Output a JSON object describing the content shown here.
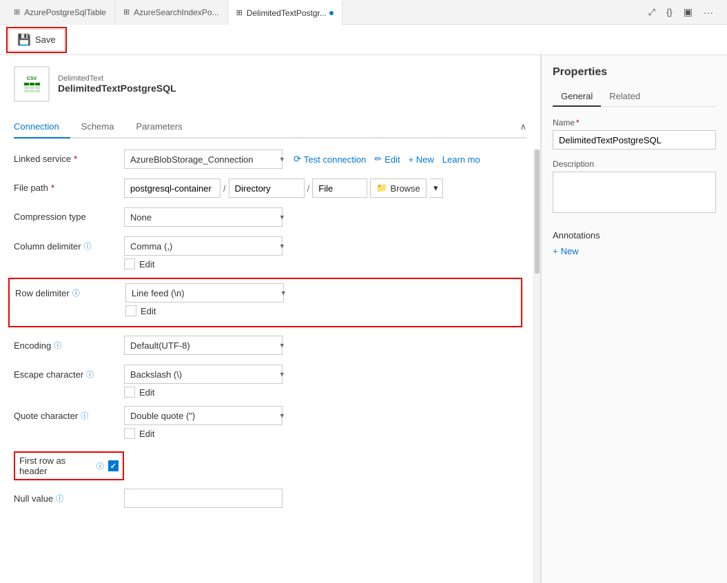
{
  "tabs": [
    {
      "id": "tab1",
      "label": "AzurePostgreSqlTable",
      "icon": "⊞",
      "active": false
    },
    {
      "id": "tab2",
      "label": "AzureSearchIndexPo...",
      "icon": "⊞",
      "active": false
    },
    {
      "id": "tab3",
      "label": "DelimitedTextPostgr...",
      "icon": "⊞",
      "active": true,
      "dot": true
    }
  ],
  "toolbar": {
    "save_label": "Save"
  },
  "dataset": {
    "type_label": "DelimitedText",
    "name_label": "DelimitedTextPostgreSQL"
  },
  "content_tabs": [
    {
      "id": "connection",
      "label": "Connection",
      "active": true
    },
    {
      "id": "schema",
      "label": "Schema",
      "active": false
    },
    {
      "id": "parameters",
      "label": "Parameters",
      "active": false
    }
  ],
  "form": {
    "linked_service_label": "Linked service",
    "linked_service_required": "*",
    "linked_service_value": "AzureBlobStorage_Connection",
    "linked_service_actions": {
      "test_connection": "Test connection",
      "edit": "Edit",
      "new": "+ New",
      "learn_more": "Learn mo"
    },
    "file_path_label": "File path",
    "file_path_required": "*",
    "file_path_container": "postgresql-container",
    "file_path_directory": "Directory",
    "file_path_file": "File",
    "browse_label": "Browse",
    "compression_type_label": "Compression type",
    "compression_type_value": "None",
    "column_delimiter_label": "Column delimiter",
    "column_delimiter_info": "ⓘ",
    "column_delimiter_value": "Comma (,)",
    "column_delimiter_edit_label": "Edit",
    "row_delimiter_label": "Row delimiter",
    "row_delimiter_info": "ⓘ",
    "row_delimiter_value": "Line feed (\\n)",
    "row_delimiter_edit_label": "Edit",
    "encoding_label": "Encoding",
    "encoding_info": "ⓘ",
    "encoding_value": "Default(UTF-8)",
    "escape_character_label": "Escape character",
    "escape_character_info": "ⓘ",
    "escape_character_value": "Backslash (\\)",
    "escape_character_edit_label": "Edit",
    "quote_character_label": "Quote character",
    "quote_character_info": "ⓘ",
    "quote_character_value": "Double quote (\")",
    "quote_character_edit_label": "Edit",
    "first_row_header_label": "First row as header",
    "first_row_header_info": "ⓘ",
    "first_row_header_checked": true,
    "null_value_label": "Null value",
    "null_value_info": "ⓘ"
  },
  "properties": {
    "title": "Properties",
    "tabs": [
      {
        "id": "general",
        "label": "General",
        "active": true
      },
      {
        "id": "related",
        "label": "Related",
        "active": false
      }
    ],
    "name_label": "Name",
    "name_required": "*",
    "name_value": "DelimitedTextPostgreSQL",
    "description_label": "Description",
    "description_placeholder": "",
    "annotations_label": "Annotations",
    "new_annotation_label": "New"
  }
}
